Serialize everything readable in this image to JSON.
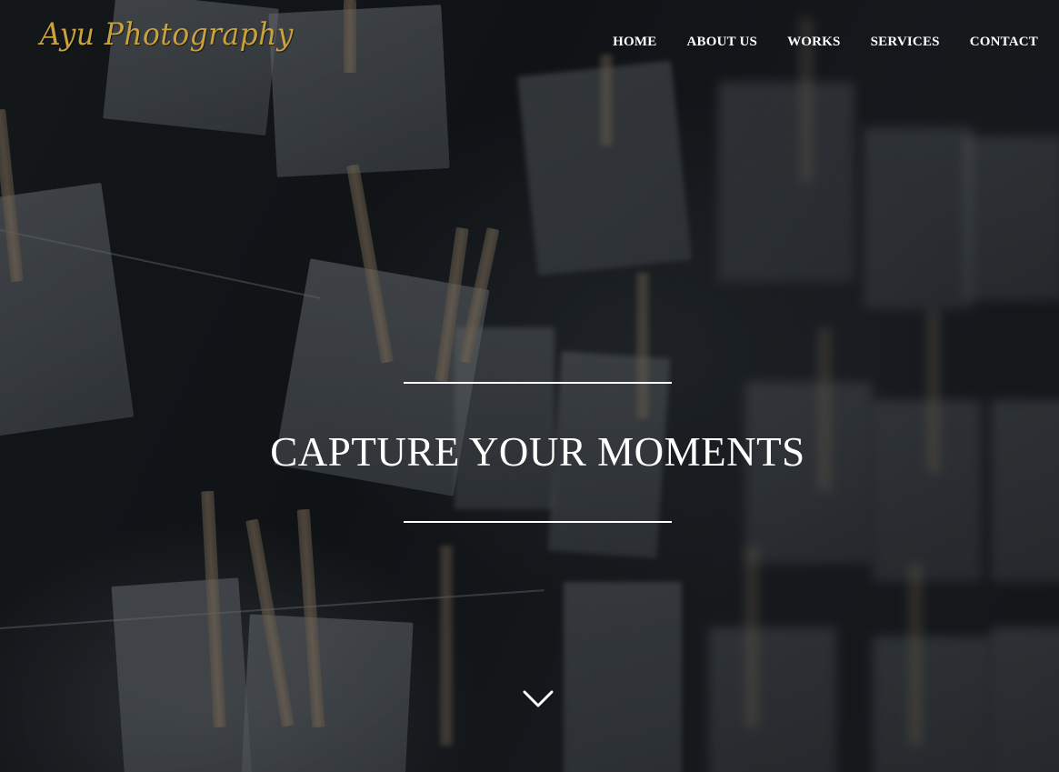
{
  "site": {
    "logo_text": "Ayu Photography",
    "brand_color": "#c9a23c"
  },
  "nav": {
    "items": [
      {
        "label": "HOME"
      },
      {
        "label": "ABOUT US"
      },
      {
        "label": "WORKS"
      },
      {
        "label": "SERVICES"
      },
      {
        "label": "CONTACT"
      }
    ]
  },
  "hero": {
    "title": "CAPTURE YOUR MOMENTS",
    "scroll_icon": "chevron-down-icon",
    "background": "photos hanging on clothespins, dark overlay"
  }
}
